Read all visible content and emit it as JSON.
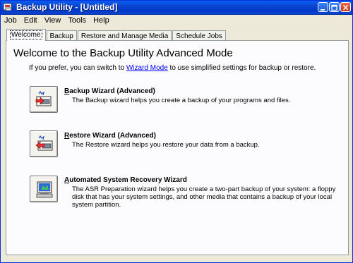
{
  "window": {
    "title": "Backup Utility - [Untitled]"
  },
  "menu": [
    "Job",
    "Edit",
    "View",
    "Tools",
    "Help"
  ],
  "tabs": [
    {
      "label": "Welcome",
      "active": true
    },
    {
      "label": "Backup",
      "active": false
    },
    {
      "label": "Restore and Manage Media",
      "active": false
    },
    {
      "label": "Schedule Jobs",
      "active": false
    }
  ],
  "welcome": {
    "heading": "Welcome to the Backup Utility Advanced Mode",
    "intro_before": "If you prefer, you can switch to ",
    "intro_link": "Wizard Mode",
    "intro_after": " to use simplified settings for backup or restore."
  },
  "wizards": [
    {
      "title_first": "B",
      "title_rest": "ackup Wizard (Advanced)",
      "description": "The Backup wizard helps you create a backup of your programs and files."
    },
    {
      "title_first": "R",
      "title_rest": "estore Wizard (Advanced)",
      "description": "The Restore wizard helps you restore your data from a backup."
    },
    {
      "title_first": "A",
      "title_rest": "utomated System Recovery Wizard",
      "description": "The ASR Preparation wizard helps you create a two-part backup of your system: a floppy disk that has your system settings, and other media that contains a backup of your local system partition."
    }
  ],
  "colors": {
    "titlebar": "#0a46d0",
    "panel": "#fcfcfe",
    "chrome": "#ece9d8",
    "link": "#0000ff"
  },
  "icons": [
    "backup-utility-icon",
    "minimize-icon",
    "maximize-icon",
    "close-icon",
    "backup-wizard-icon",
    "restore-wizard-icon",
    "asr-wizard-icon"
  ]
}
